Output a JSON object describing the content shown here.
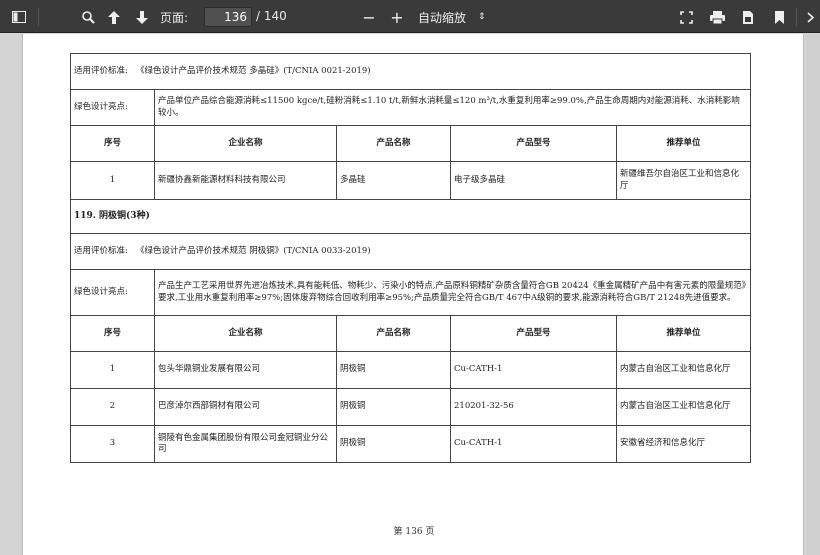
{
  "toolbar": {
    "page_label": "页面:",
    "current_page": "136",
    "total_pages": "/ 140",
    "zoom_label": "自动缩放",
    "zoom_caret": "⇕",
    "minus": "−",
    "plus": "+"
  },
  "section1": {
    "std_label": "适用评价标准:",
    "std_value": "《绿色设计产品评价技术规范 多晶硅》(T/CNIA 0021-2019)",
    "design_label": "绿色设计亮点:",
    "design_value": "产品单位产品综合能源消耗≤11500 kgce/t,硅粉消耗≤1.10 t/t,新鲜水消耗量≤120 m³/t,水重复利用率≥99.0%,产品生命周期内对能源消耗、水消耗影响较小。",
    "headers": [
      "序号",
      "企业名称",
      "产品名称",
      "产品型号",
      "推荐单位"
    ],
    "rows": [
      {
        "no": "1",
        "company": "新疆协鑫新能源材料科技有限公司",
        "product": "多晶硅",
        "model": "电子级多晶硅",
        "recommender": "新疆维吾尔自治区工业和信息化厅"
      }
    ]
  },
  "section2": {
    "title": "119. 阴极铜(3种)",
    "std_label": "适用评价标准:",
    "std_value": "《绿色设计产品评价技术规范 阴极铜》(T/CNIA 0033-2019)",
    "design_label": "绿色设计亮点:",
    "design_value": "产品生产工艺采用世界先进冶炼技术,具有能耗低、物耗少、污染小的特点,产品原料铜精矿杂质含量符合GB 20424《重金属精矿产品中有害元素的限量规范》要求,工业用水重复利用率≥97%;固体废弃物综合回收利用率≥95%;产品质量完全符合GB/T 467中A级铜的要求,能源消耗符合GB/T 21248先进值要求。",
    "headers": [
      "序号",
      "企业名称",
      "产品名称",
      "产品型号",
      "推荐单位"
    ],
    "rows": [
      {
        "no": "1",
        "company": "包头华鼎铜业发展有限公司",
        "product": "阴极铜",
        "model": "Cu-CATH-1",
        "recommender": "内蒙古自治区工业和信息化厅"
      },
      {
        "no": "2",
        "company": "巴彦淖尔西部铜材有限公司",
        "product": "阴极铜",
        "model": "210201-32-56",
        "recommender": "内蒙古自治区工业和信息化厅"
      },
      {
        "no": "3",
        "company": "铜陵有色金属集团股份有限公司金冠铜业分公司",
        "product": "阴极铜",
        "model": "Cu-CATH-1",
        "recommender": "安徽省经济和信息化厅"
      }
    ]
  },
  "footer": "第 136 页"
}
